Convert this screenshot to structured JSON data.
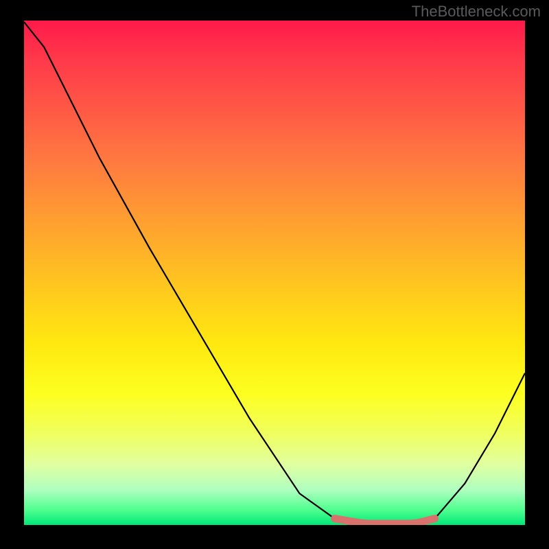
{
  "watermark": "TheBottleneck.com",
  "chart_data": {
    "type": "line",
    "x": [
      0,
      0.04,
      0.08,
      0.15,
      0.25,
      0.35,
      0.45,
      0.55,
      0.62,
      0.68,
      0.72,
      0.78,
      0.82,
      0.88,
      0.94,
      1.0
    ],
    "y": [
      1.0,
      0.95,
      0.87,
      0.73,
      0.55,
      0.38,
      0.21,
      0.06,
      0.01,
      0.0,
      0.0,
      0.0,
      0.01,
      0.08,
      0.18,
      0.3
    ],
    "xlim": [
      0,
      1
    ],
    "ylim": [
      0,
      1
    ],
    "title": "",
    "xlabel": "",
    "ylabel": "",
    "notes": "Bottleneck-style curve. X axis normalized 0–1 (no visible tick labels present). Y axis normalized 0–1 where 1.0 = top (red / high bottleneck) and 0.0 = bottom (green / optimal). Highlighted flat optimal region roughly x∈[0.62, 0.82].",
    "highlight_region": {
      "x_start": 0.62,
      "x_end": 0.82
    },
    "background_gradient": {
      "top": "#ff1a4a",
      "mid": "#ffe810",
      "bottom": "#00e878"
    },
    "curve_color": "#000000",
    "highlight_color": "#d9716c"
  }
}
